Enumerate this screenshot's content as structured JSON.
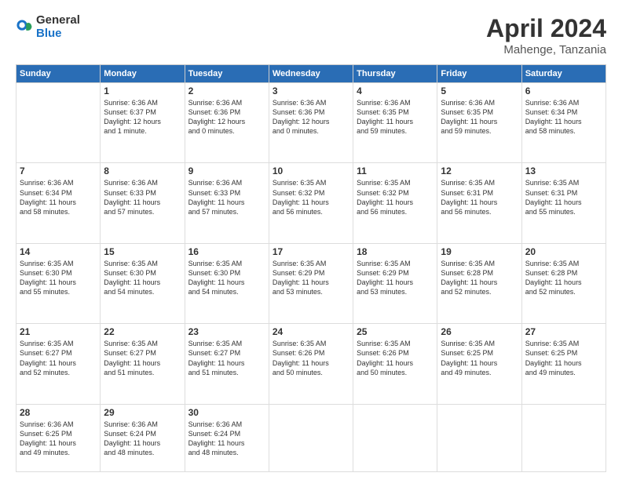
{
  "logo": {
    "general": "General",
    "blue": "Blue"
  },
  "title": {
    "month": "April 2024",
    "location": "Mahenge, Tanzania"
  },
  "headers": [
    "Sunday",
    "Monday",
    "Tuesday",
    "Wednesday",
    "Thursday",
    "Friday",
    "Saturday"
  ],
  "weeks": [
    [
      {
        "day": "",
        "info": ""
      },
      {
        "day": "1",
        "info": "Sunrise: 6:36 AM\nSunset: 6:37 PM\nDaylight: 12 hours\nand 1 minute."
      },
      {
        "day": "2",
        "info": "Sunrise: 6:36 AM\nSunset: 6:36 PM\nDaylight: 12 hours\nand 0 minutes."
      },
      {
        "day": "3",
        "info": "Sunrise: 6:36 AM\nSunset: 6:36 PM\nDaylight: 12 hours\nand 0 minutes."
      },
      {
        "day": "4",
        "info": "Sunrise: 6:36 AM\nSunset: 6:35 PM\nDaylight: 11 hours\nand 59 minutes."
      },
      {
        "day": "5",
        "info": "Sunrise: 6:36 AM\nSunset: 6:35 PM\nDaylight: 11 hours\nand 59 minutes."
      },
      {
        "day": "6",
        "info": "Sunrise: 6:36 AM\nSunset: 6:34 PM\nDaylight: 11 hours\nand 58 minutes."
      }
    ],
    [
      {
        "day": "7",
        "info": "Sunrise: 6:36 AM\nSunset: 6:34 PM\nDaylight: 11 hours\nand 58 minutes."
      },
      {
        "day": "8",
        "info": "Sunrise: 6:36 AM\nSunset: 6:33 PM\nDaylight: 11 hours\nand 57 minutes."
      },
      {
        "day": "9",
        "info": "Sunrise: 6:36 AM\nSunset: 6:33 PM\nDaylight: 11 hours\nand 57 minutes."
      },
      {
        "day": "10",
        "info": "Sunrise: 6:35 AM\nSunset: 6:32 PM\nDaylight: 11 hours\nand 56 minutes."
      },
      {
        "day": "11",
        "info": "Sunrise: 6:35 AM\nSunset: 6:32 PM\nDaylight: 11 hours\nand 56 minutes."
      },
      {
        "day": "12",
        "info": "Sunrise: 6:35 AM\nSunset: 6:31 PM\nDaylight: 11 hours\nand 56 minutes."
      },
      {
        "day": "13",
        "info": "Sunrise: 6:35 AM\nSunset: 6:31 PM\nDaylight: 11 hours\nand 55 minutes."
      }
    ],
    [
      {
        "day": "14",
        "info": "Sunrise: 6:35 AM\nSunset: 6:30 PM\nDaylight: 11 hours\nand 55 minutes."
      },
      {
        "day": "15",
        "info": "Sunrise: 6:35 AM\nSunset: 6:30 PM\nDaylight: 11 hours\nand 54 minutes."
      },
      {
        "day": "16",
        "info": "Sunrise: 6:35 AM\nSunset: 6:30 PM\nDaylight: 11 hours\nand 54 minutes."
      },
      {
        "day": "17",
        "info": "Sunrise: 6:35 AM\nSunset: 6:29 PM\nDaylight: 11 hours\nand 53 minutes."
      },
      {
        "day": "18",
        "info": "Sunrise: 6:35 AM\nSunset: 6:29 PM\nDaylight: 11 hours\nand 53 minutes."
      },
      {
        "day": "19",
        "info": "Sunrise: 6:35 AM\nSunset: 6:28 PM\nDaylight: 11 hours\nand 52 minutes."
      },
      {
        "day": "20",
        "info": "Sunrise: 6:35 AM\nSunset: 6:28 PM\nDaylight: 11 hours\nand 52 minutes."
      }
    ],
    [
      {
        "day": "21",
        "info": "Sunrise: 6:35 AM\nSunset: 6:27 PM\nDaylight: 11 hours\nand 52 minutes."
      },
      {
        "day": "22",
        "info": "Sunrise: 6:35 AM\nSunset: 6:27 PM\nDaylight: 11 hours\nand 51 minutes."
      },
      {
        "day": "23",
        "info": "Sunrise: 6:35 AM\nSunset: 6:27 PM\nDaylight: 11 hours\nand 51 minutes."
      },
      {
        "day": "24",
        "info": "Sunrise: 6:35 AM\nSunset: 6:26 PM\nDaylight: 11 hours\nand 50 minutes."
      },
      {
        "day": "25",
        "info": "Sunrise: 6:35 AM\nSunset: 6:26 PM\nDaylight: 11 hours\nand 50 minutes."
      },
      {
        "day": "26",
        "info": "Sunrise: 6:35 AM\nSunset: 6:25 PM\nDaylight: 11 hours\nand 49 minutes."
      },
      {
        "day": "27",
        "info": "Sunrise: 6:35 AM\nSunset: 6:25 PM\nDaylight: 11 hours\nand 49 minutes."
      }
    ],
    [
      {
        "day": "28",
        "info": "Sunrise: 6:36 AM\nSunset: 6:25 PM\nDaylight: 11 hours\nand 49 minutes."
      },
      {
        "day": "29",
        "info": "Sunrise: 6:36 AM\nSunset: 6:24 PM\nDaylight: 11 hours\nand 48 minutes."
      },
      {
        "day": "30",
        "info": "Sunrise: 6:36 AM\nSunset: 6:24 PM\nDaylight: 11 hours\nand 48 minutes."
      },
      {
        "day": "",
        "info": ""
      },
      {
        "day": "",
        "info": ""
      },
      {
        "day": "",
        "info": ""
      },
      {
        "day": "",
        "info": ""
      }
    ]
  ]
}
